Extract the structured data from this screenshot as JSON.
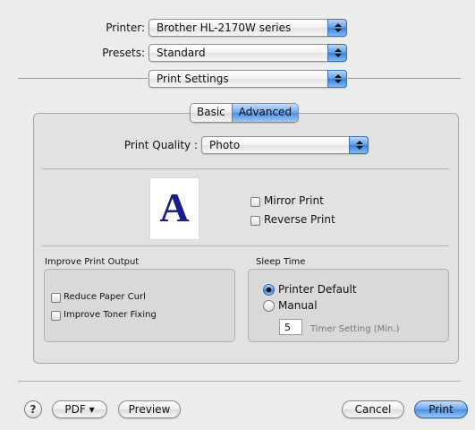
{
  "printer": {
    "label": "Printer:",
    "value": "Brother HL-2170W series"
  },
  "presets": {
    "label": "Presets:",
    "value": "Standard"
  },
  "panel_popup": {
    "value": "Print Settings"
  },
  "tabs": [
    {
      "label": "Basic"
    },
    {
      "label": "Advanced",
      "selected": true
    }
  ],
  "print_quality": {
    "label": "Print Quality :",
    "value": "Photo"
  },
  "preview": {
    "glyph": "A"
  },
  "mirror_print": {
    "label": "Mirror Print",
    "checked": false
  },
  "reverse_print": {
    "label": "Reverse Print",
    "checked": false
  },
  "improve_output": {
    "title": "Improve Print Output",
    "reduce_curl": {
      "label": "Reduce Paper Curl",
      "checked": false
    },
    "toner_fixing": {
      "label": "Improve Toner Fixing",
      "checked": false
    }
  },
  "sleep_time": {
    "title": "Sleep Time",
    "printer_default": {
      "label": "Printer Default",
      "selected": true
    },
    "manual": {
      "label": "Manual",
      "selected": false
    },
    "timer_value": "5",
    "timer_label": "Timer Setting (Min.)"
  },
  "footer": {
    "help": "?",
    "pdf": "PDF ▾",
    "preview": "Preview",
    "cancel": "Cancel",
    "print": "Print"
  }
}
